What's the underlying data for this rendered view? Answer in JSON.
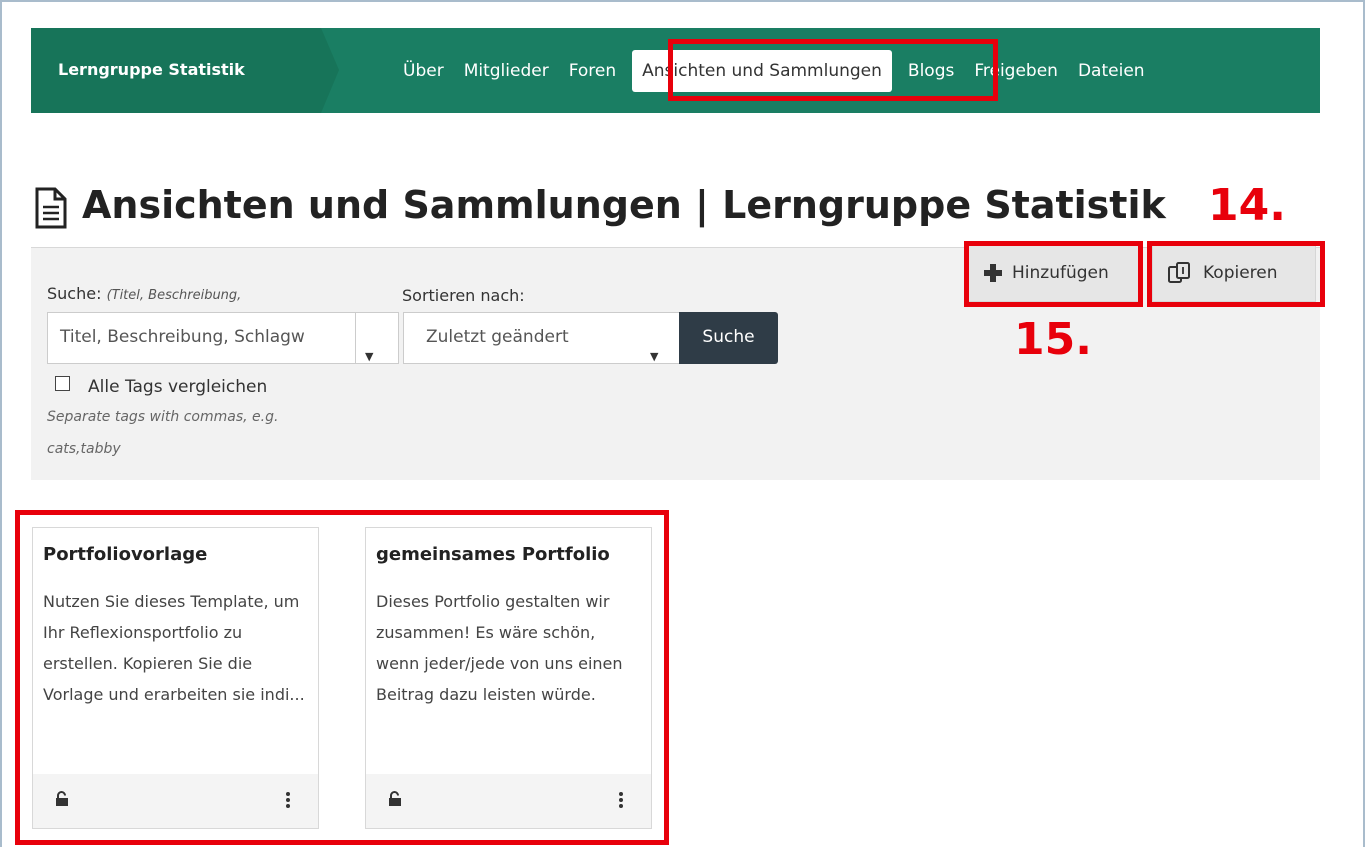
{
  "nav": {
    "group_title": "Lerngruppe Statistik",
    "items": [
      {
        "label": "Über"
      },
      {
        "label": "Mitglieder"
      },
      {
        "label": "Foren"
      },
      {
        "label": "Ansichten und Sammlungen",
        "active": true
      },
      {
        "label": "Blogs"
      },
      {
        "label": "Freigeben"
      },
      {
        "label": "Dateien"
      }
    ]
  },
  "page": {
    "title": "Ansichten und Sammlungen | Lerngruppe Statistik",
    "title_icon": "file-text-icon"
  },
  "annotations": {
    "a14": "14.",
    "a15": "15."
  },
  "search": {
    "label": "Suche:",
    "label_hint": "(Titel, Beschreibung,",
    "input_value": "Titel, Beschreibung, Schlagw",
    "sort_label": "Sortieren nach:",
    "sort_value": "Zuletzt geändert",
    "button": "Suche",
    "match_all_tags": "Alle Tags vergleichen",
    "tags_hint_line1": "Separate tags with commas, e.g.",
    "tags_hint_line2": "cats,tabby"
  },
  "actions": {
    "add": "Hinzufügen",
    "copy": "Kopieren"
  },
  "cards": [
    {
      "title": "Portfoliovorlage",
      "description": "Nutzen Sie dieses Template, um Ihr Reflexionsportfolio zu erstellen. Kopieren Sie die Vorlage und erarbeiten sie indi..."
    },
    {
      "title": "gemeinsames Portfolio",
      "description": "Dieses Portfolio gestalten wir zusammen! Es wäre schön, wenn jeder/jede von uns einen Beitrag dazu leisten würde."
    }
  ],
  "colors": {
    "nav_bg": "#1a7e63",
    "annotation_red": "#e8000b",
    "search_button": "#2f3c47"
  }
}
